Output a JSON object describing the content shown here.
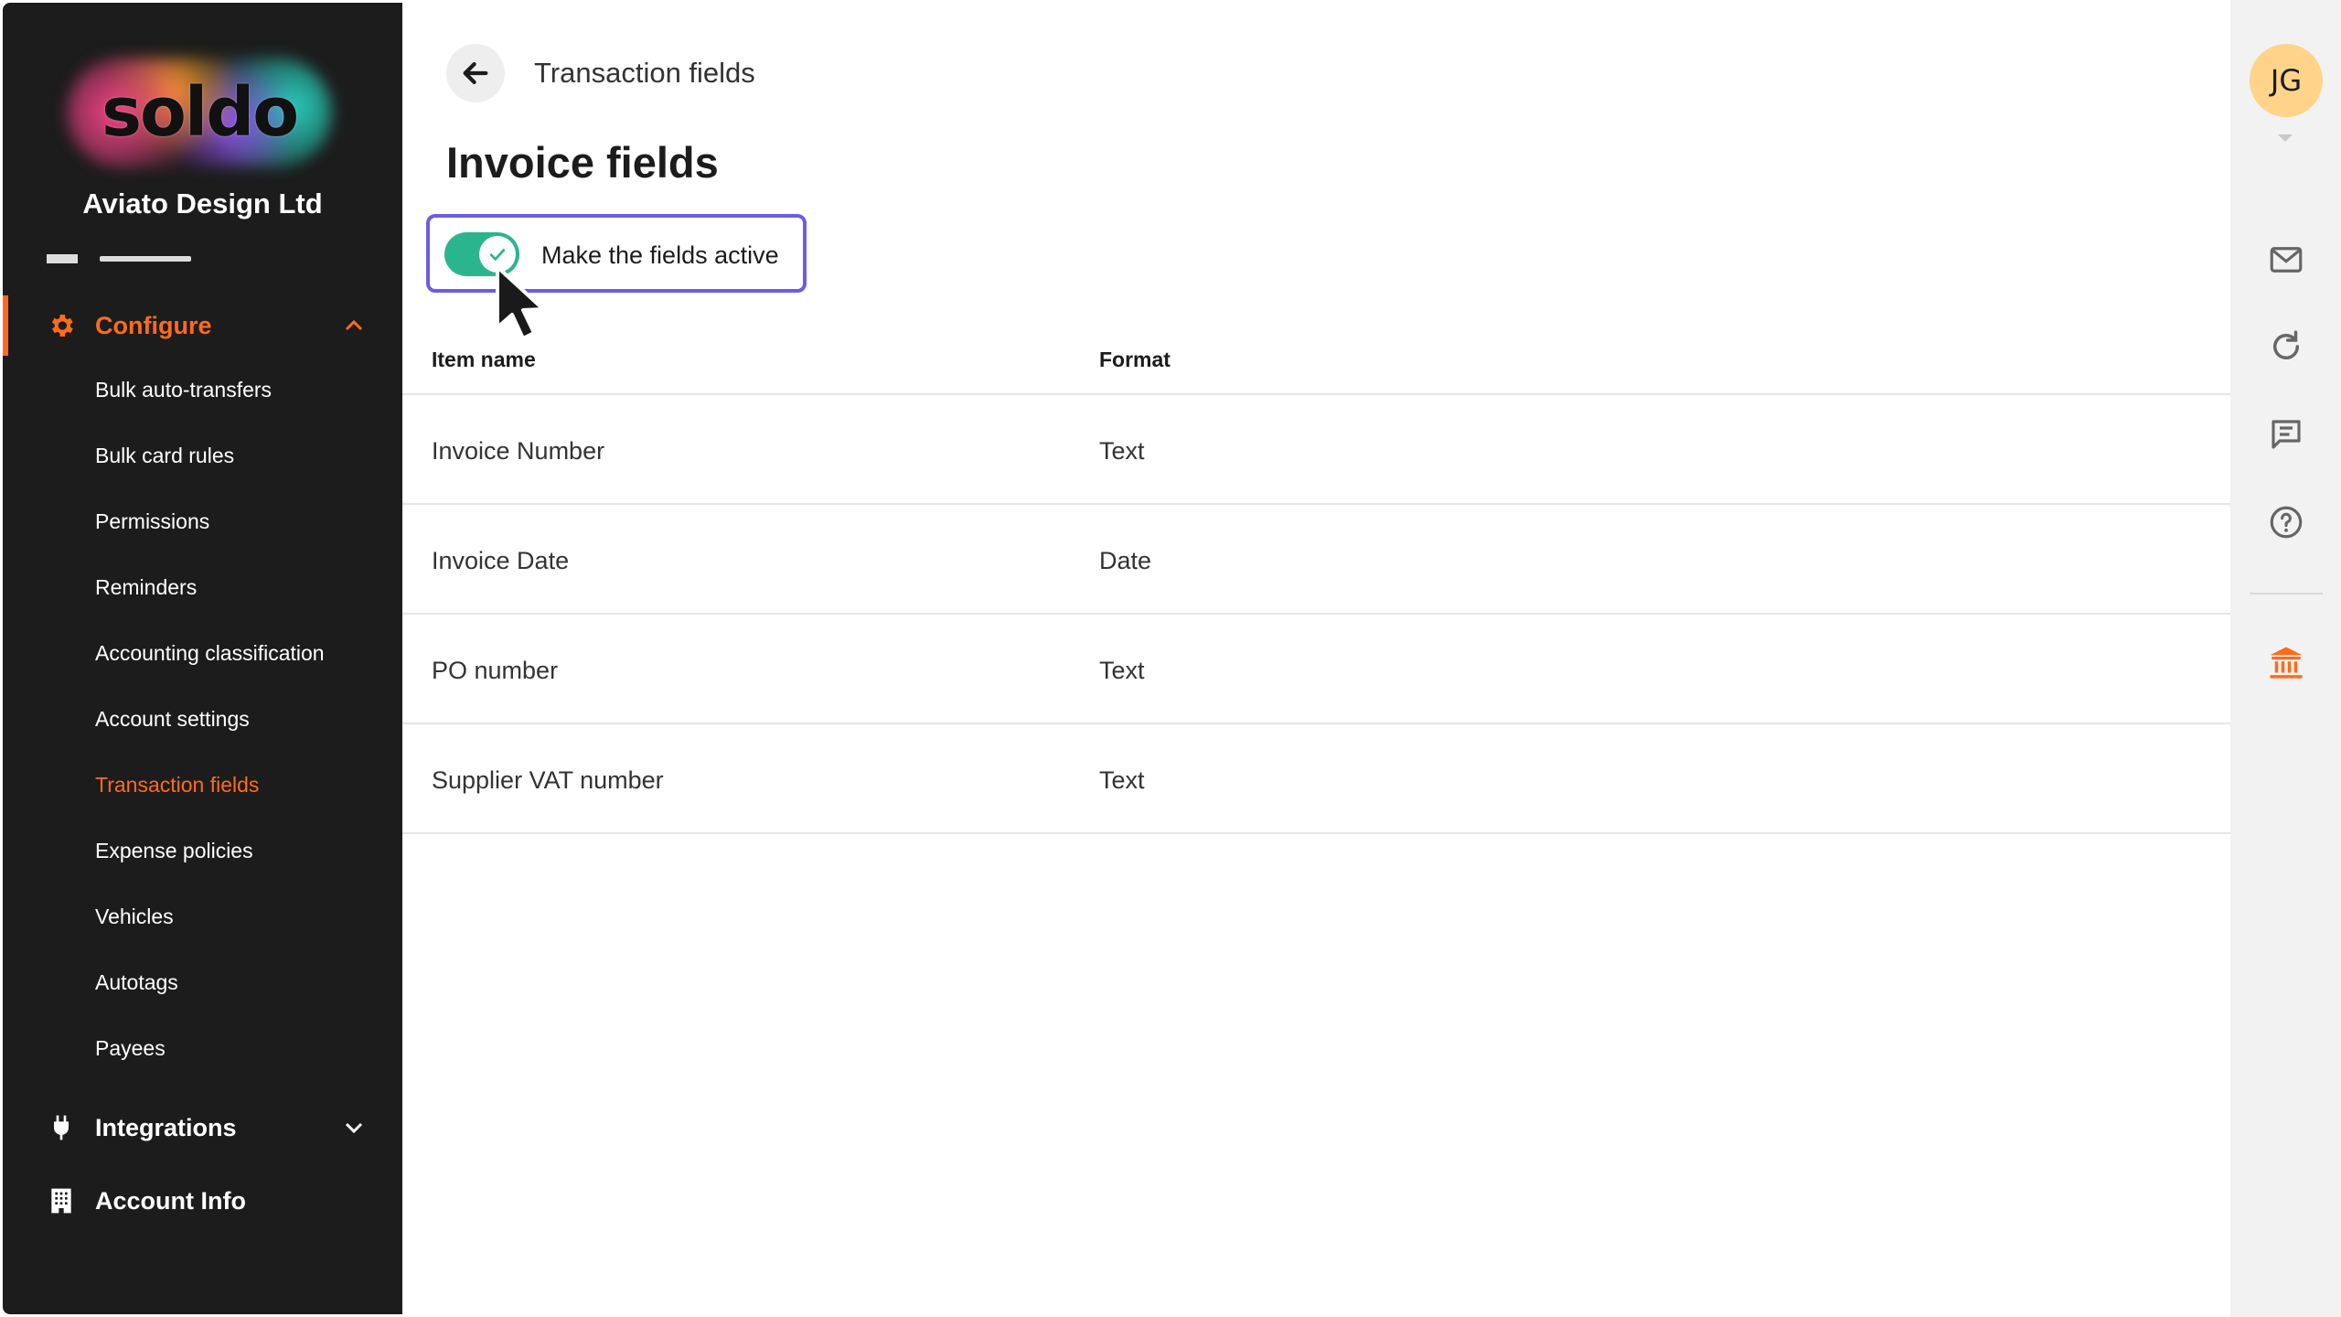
{
  "sidebar": {
    "logo_text": "soldo",
    "company": "Aviato Design Ltd",
    "configure": {
      "label": "Configure",
      "expanded": true
    },
    "items": [
      {
        "label": "Bulk auto-transfers"
      },
      {
        "label": "Bulk card rules"
      },
      {
        "label": "Permissions"
      },
      {
        "label": "Reminders"
      },
      {
        "label": "Accounting classification"
      },
      {
        "label": "Account settings"
      },
      {
        "label": "Transaction fields",
        "active": true
      },
      {
        "label": "Expense policies"
      },
      {
        "label": "Vehicles"
      },
      {
        "label": "Autotags"
      },
      {
        "label": "Payees"
      }
    ],
    "integrations": {
      "label": "Integrations"
    },
    "account_info": {
      "label": "Account Info"
    },
    "accent": "#ff6b1a"
  },
  "main": {
    "breadcrumb": "Transaction fields",
    "title": "Invoice fields",
    "toggle": {
      "label": "Make the fields active",
      "on": true,
      "color": "#2bb58f"
    },
    "table": {
      "headers": [
        "Item name",
        "Format"
      ],
      "rows": [
        [
          "Invoice Number",
          "Text"
        ],
        [
          "Invoice Date",
          "Date"
        ],
        [
          "PO number",
          "Text"
        ],
        [
          "Supplier VAT number",
          "Text"
        ]
      ]
    }
  },
  "rail": {
    "avatar_initials": "JG",
    "icons": [
      "mail-icon",
      "refresh-icon",
      "chat-icon",
      "help-icon",
      "bank-icon"
    ]
  }
}
